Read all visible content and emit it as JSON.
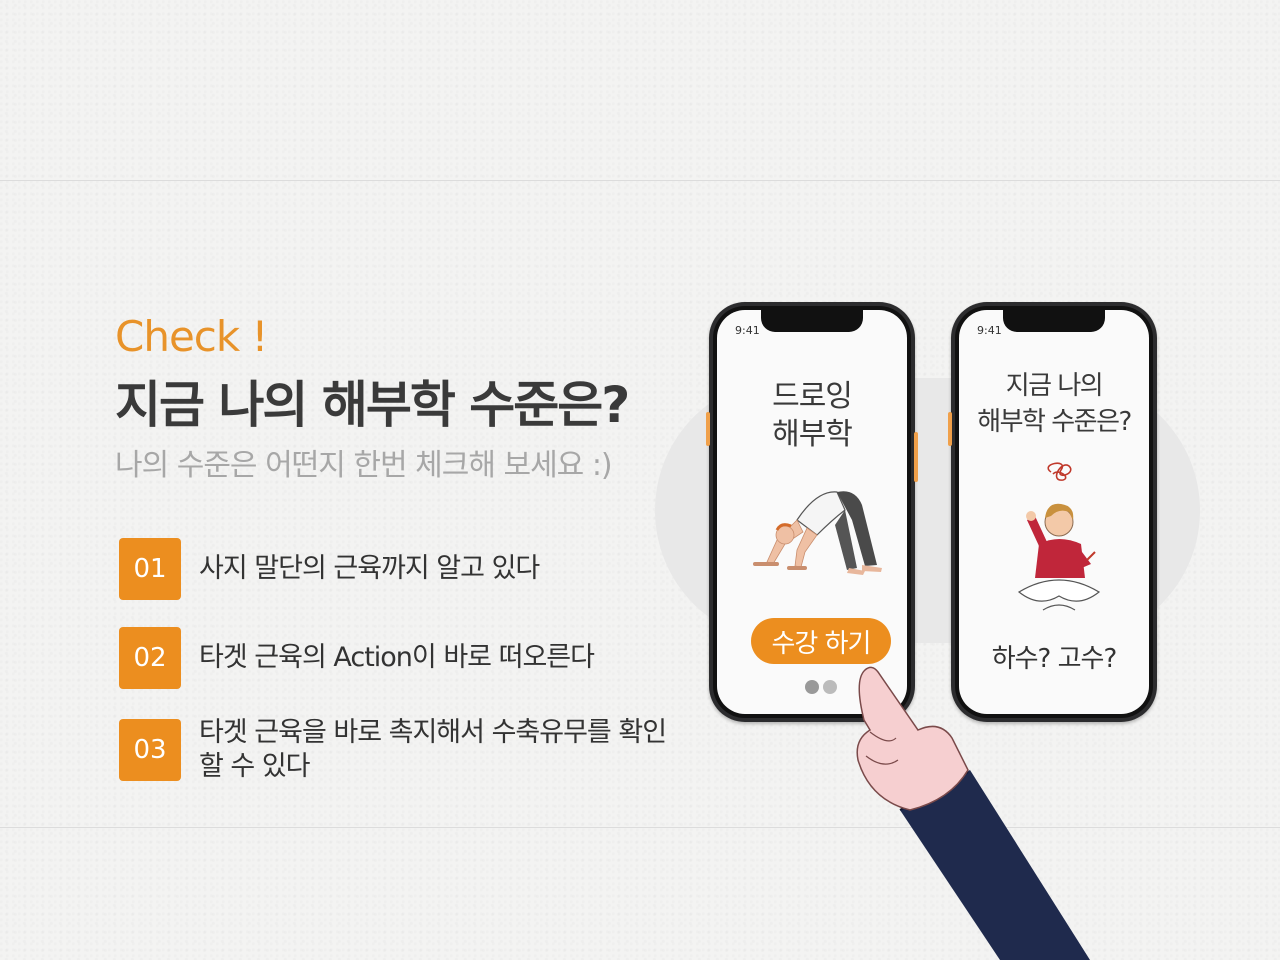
{
  "header": {
    "check": "Check !",
    "title": "지금 나의 해부학 수준은?",
    "subtitle": "나의 수준은 어떤지 한번 체크해 보세요 :)"
  },
  "items": [
    {
      "num": "01",
      "text": "사지 말단의 근육까지 알고 있다"
    },
    {
      "num": "02",
      "text": "타겟 근육의 Action이 바로 떠오른다"
    },
    {
      "num": "03",
      "text": "타겟 근육을 바로 촉지해서 수축유무를 확인할 수 있다"
    }
  ],
  "phone1": {
    "time": "9:41",
    "line1": "드로잉",
    "line2": "해부학",
    "button": "수강 하기"
  },
  "phone2": {
    "time": "9:41",
    "line1": "지금 나의",
    "line2": "해부학 수준은?",
    "footer": "하수? 고수?"
  },
  "colors": {
    "accent": "#ec8e1f",
    "title": "#3a3a3a",
    "subtitle": "#a7a7a7",
    "sleeve": "#1f2a4d"
  }
}
